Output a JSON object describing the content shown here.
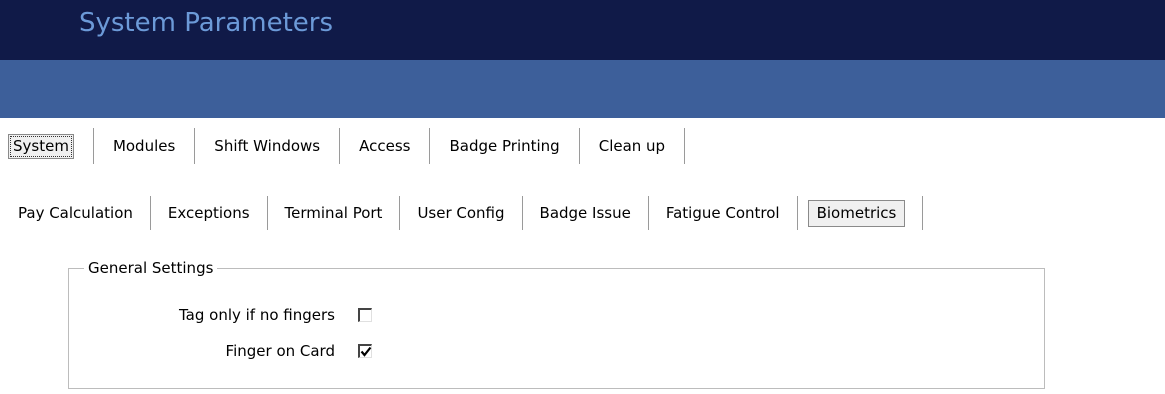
{
  "window": {
    "title": "System Parameters"
  },
  "main_tabs": [
    {
      "label": "System",
      "selected": true
    },
    {
      "label": "Modules",
      "selected": false
    },
    {
      "label": "Shift Windows",
      "selected": false
    },
    {
      "label": "Access",
      "selected": false
    },
    {
      "label": "Badge Printing",
      "selected": false
    },
    {
      "label": "Clean up",
      "selected": false
    }
  ],
  "sub_tabs": [
    {
      "label": "Pay Calculation",
      "selected": false
    },
    {
      "label": "Exceptions",
      "selected": false
    },
    {
      "label": "Terminal Port",
      "selected": false
    },
    {
      "label": "User Config",
      "selected": false
    },
    {
      "label": "Badge Issue",
      "selected": false
    },
    {
      "label": "Fatigue Control",
      "selected": false
    },
    {
      "label": "Biometrics",
      "selected": true
    }
  ],
  "general_settings": {
    "title": "General Settings",
    "tag_only_if_no_fingers": {
      "label": "Tag only if no fingers",
      "checked": false
    },
    "finger_on_card": {
      "label": "Finger on Card",
      "checked": true
    }
  },
  "colors": {
    "title_bar": "#101a48",
    "title_text": "#6c9ad8",
    "band": "#3d5f9a"
  }
}
